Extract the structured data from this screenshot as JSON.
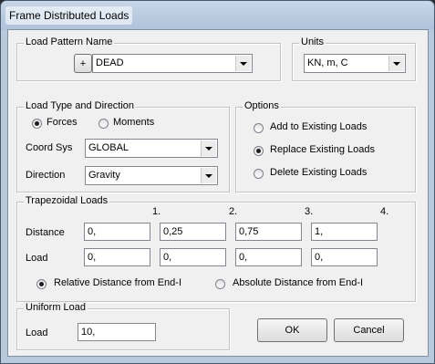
{
  "window": {
    "title": "Frame Distributed Loads"
  },
  "load_pattern": {
    "legend": "Load Pattern Name",
    "add_label": "+",
    "selected": "DEAD"
  },
  "units": {
    "legend": "Units",
    "selected": "KN, m, C"
  },
  "load_type": {
    "legend": "Load Type and Direction",
    "forces_label": "Forces",
    "moments_label": "Moments",
    "selected": "Forces",
    "coord_sys_label": "Coord Sys",
    "coord_sys_value": "GLOBAL",
    "direction_label": "Direction",
    "direction_value": "Gravity"
  },
  "options": {
    "legend": "Options",
    "add_label": "Add to Existing Loads",
    "replace_label": "Replace Existing Loads",
    "delete_label": "Delete Existing Loads",
    "selected": "Replace Existing Loads"
  },
  "trapezoidal": {
    "legend": "Trapezoidal Loads",
    "columns": [
      "1.",
      "2.",
      "3.",
      "4."
    ],
    "distance_label": "Distance",
    "distances": [
      "0,",
      "0,25",
      "0,75",
      "1,"
    ],
    "load_label": "Load",
    "loads": [
      "0,",
      "0,",
      "0,",
      "0,"
    ],
    "relative_label": "Relative Distance from End-I",
    "absolute_label": "Absolute Distance from End-I",
    "selected": "Relative Distance from End-I"
  },
  "uniform": {
    "legend": "Uniform Load",
    "load_label": "Load",
    "load_value": "10,"
  },
  "buttons": {
    "ok": "OK",
    "cancel": "Cancel"
  },
  "colors": {
    "titlebar": "#b9c9dc",
    "client_background": "#f0f0f0"
  },
  "icons": [
    "dropdown-arrow-icon",
    "radio-selected-icon",
    "radio-unselected-icon"
  ]
}
